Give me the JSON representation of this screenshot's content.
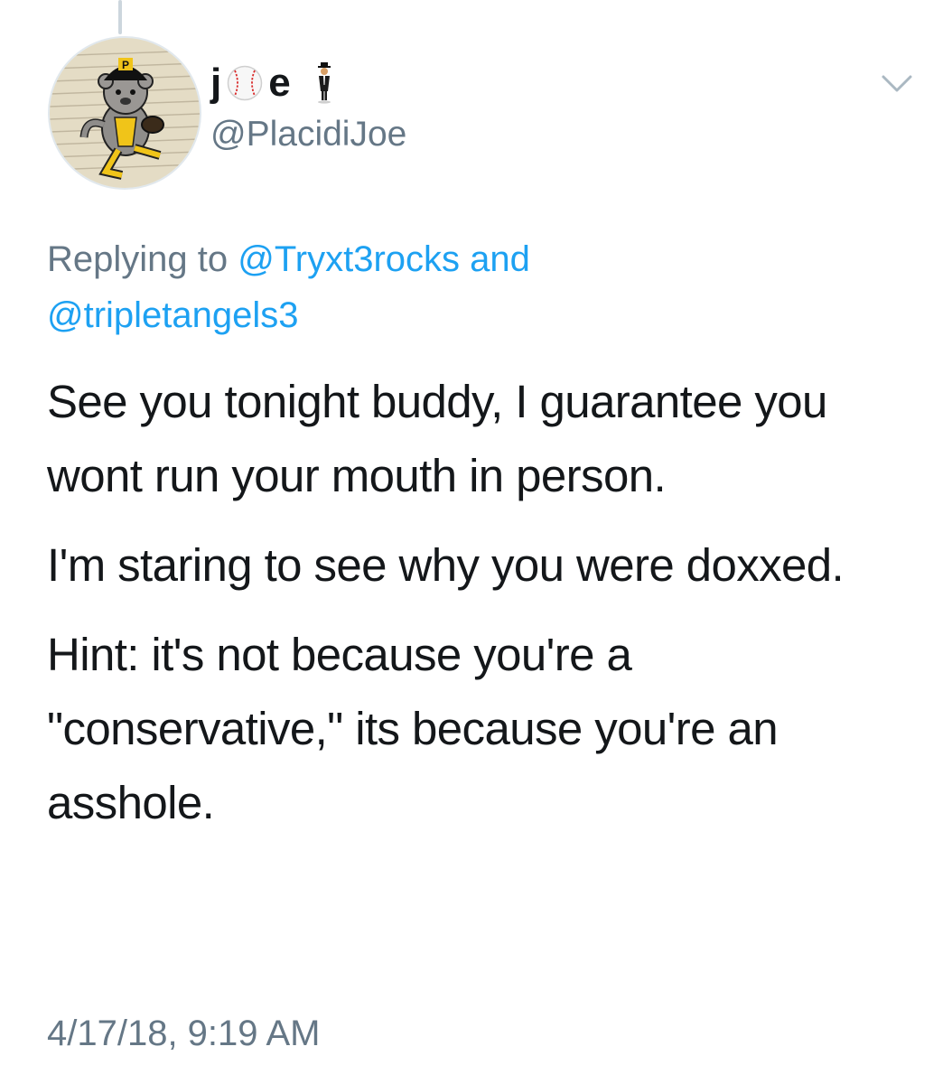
{
  "author": {
    "display_name_prefix": "j",
    "display_name_suffix": "e",
    "display_name_icons": [
      "baseball-icon",
      "man-in-suit-levitating-icon"
    ],
    "handle": "@PlacidiJoe",
    "avatar_icon": "pirate-bear-mascot-icon"
  },
  "reply": {
    "prefix": "Replying to ",
    "mention_1": "@Tryxt3rocks",
    "connector": " and",
    "mention_2": "@tripletangels3"
  },
  "tweet": {
    "paragraphs": [
      "See you tonight buddy, I guarantee you wont run your mouth in person.",
      "I'm staring to see why you were doxxed.",
      "Hint:  it's not because you're a \"conservative,\" its because you're an asshole."
    ]
  },
  "timestamp": "4/17/18, 9:19 AM",
  "colors": {
    "text": "#14171a",
    "secondary": "#657786",
    "link": "#1da1f2",
    "thread_line": "#ccd6dd"
  }
}
